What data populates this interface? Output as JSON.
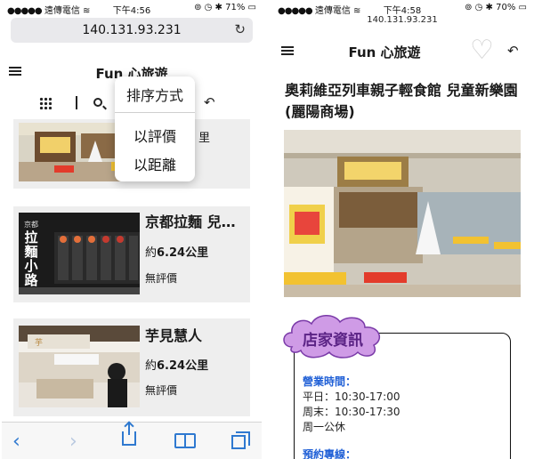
{
  "left": {
    "status": {
      "carrier": "遠傳電信",
      "time": "下午4:56",
      "battery": "71%"
    },
    "url": "140.131.93.231",
    "app_title": "Fun 心旅遊",
    "sort_popover": {
      "title": "排序方式",
      "options": [
        "以評價",
        "以距離"
      ]
    },
    "cards": [
      {
        "name": "",
        "distance_prefix": "約",
        "distance": "6.24公里",
        "rating": "無評價"
      },
      {
        "name": "京都拉麵 兒童新樂園",
        "distance_prefix": "約",
        "distance": "6.24公里",
        "rating": "無評價"
      },
      {
        "name": "芋見慧人",
        "distance_prefix": "約",
        "distance": "6.24公里",
        "rating": "無評價"
      }
    ],
    "partial_card_text": "里",
    "thumb_signs": {
      "card2_sign": "拉麵小路",
      "card2_sign_small": "京都"
    }
  },
  "right": {
    "status": {
      "carrier": "遠傳電信",
      "time": "下午4:58",
      "battery": "70%"
    },
    "url": "140.131.93.231",
    "app_title": "Fun 心旅遊",
    "detail_title": "奧莉維亞列車親子輕食館 兒童新樂園(麗陽商場)",
    "info_header": "店家資訊",
    "hours_label": "營業時間：",
    "hours": [
      "平日：10:30-17:00",
      "周末：10:30-17:30",
      "周一公休"
    ],
    "next_label": "預約專線："
  },
  "colors": {
    "accent": "#2f79d0",
    "info_cloud": "#cf9be6",
    "info_text": "#5b2385",
    "link_blue": "#1f5fd6"
  },
  "icons": [
    "wifi-icon",
    "battery-icon",
    "reload-icon",
    "hamburger-icon",
    "grid-icon",
    "search-icon",
    "undo-icon",
    "heart-icon",
    "back-icon",
    "forward-icon",
    "share-icon",
    "bookmarks-icon",
    "tabs-icon"
  ]
}
